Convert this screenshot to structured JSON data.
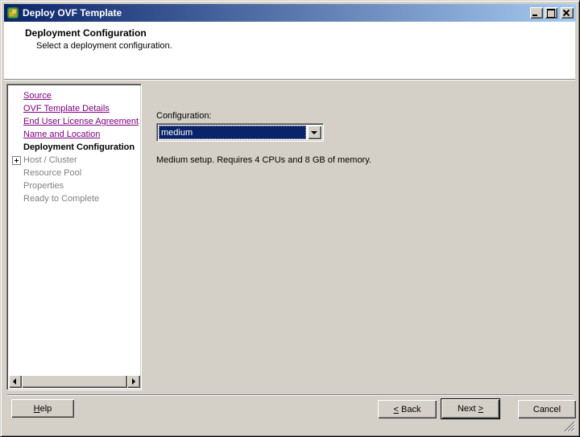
{
  "window": {
    "title": "Deploy OVF Template",
    "controls": {
      "minimize": "minimize",
      "maximize": "maximize",
      "close": "close"
    }
  },
  "header": {
    "title": "Deployment Configuration",
    "subtitle": "Select a deployment configuration."
  },
  "sidebar": {
    "items": [
      {
        "label": "Source",
        "state": "link"
      },
      {
        "label": "OVF Template Details",
        "state": "link"
      },
      {
        "label": "End User License Agreement",
        "state": "link"
      },
      {
        "label": "Name and Location",
        "state": "link"
      },
      {
        "label": "Deployment Configuration",
        "state": "active"
      },
      {
        "label": "Host / Cluster",
        "state": "disabled",
        "expandable": true
      },
      {
        "label": "Resource Pool",
        "state": "disabled"
      },
      {
        "label": "Properties",
        "state": "disabled"
      },
      {
        "label": "Ready to Complete",
        "state": "disabled"
      }
    ]
  },
  "content": {
    "configuration": {
      "label": "Configuration:",
      "value": "medium"
    },
    "description": "Medium setup. Requires 4 CPUs and 8 GB of memory."
  },
  "footer": {
    "help": {
      "accel": "H",
      "rest": "elp"
    },
    "back": {
      "accel": "<",
      "rest": " Back"
    },
    "next": {
      "pre": "Next ",
      "accel": ">"
    },
    "cancel": "Cancel"
  },
  "colors": {
    "titlebar_left": "#0a246a",
    "titlebar_right": "#a6caf0",
    "dialog_bg": "#d4d0c8",
    "selection_bg": "#0a246a",
    "link": "#800080",
    "disabled_text": "#808080"
  }
}
